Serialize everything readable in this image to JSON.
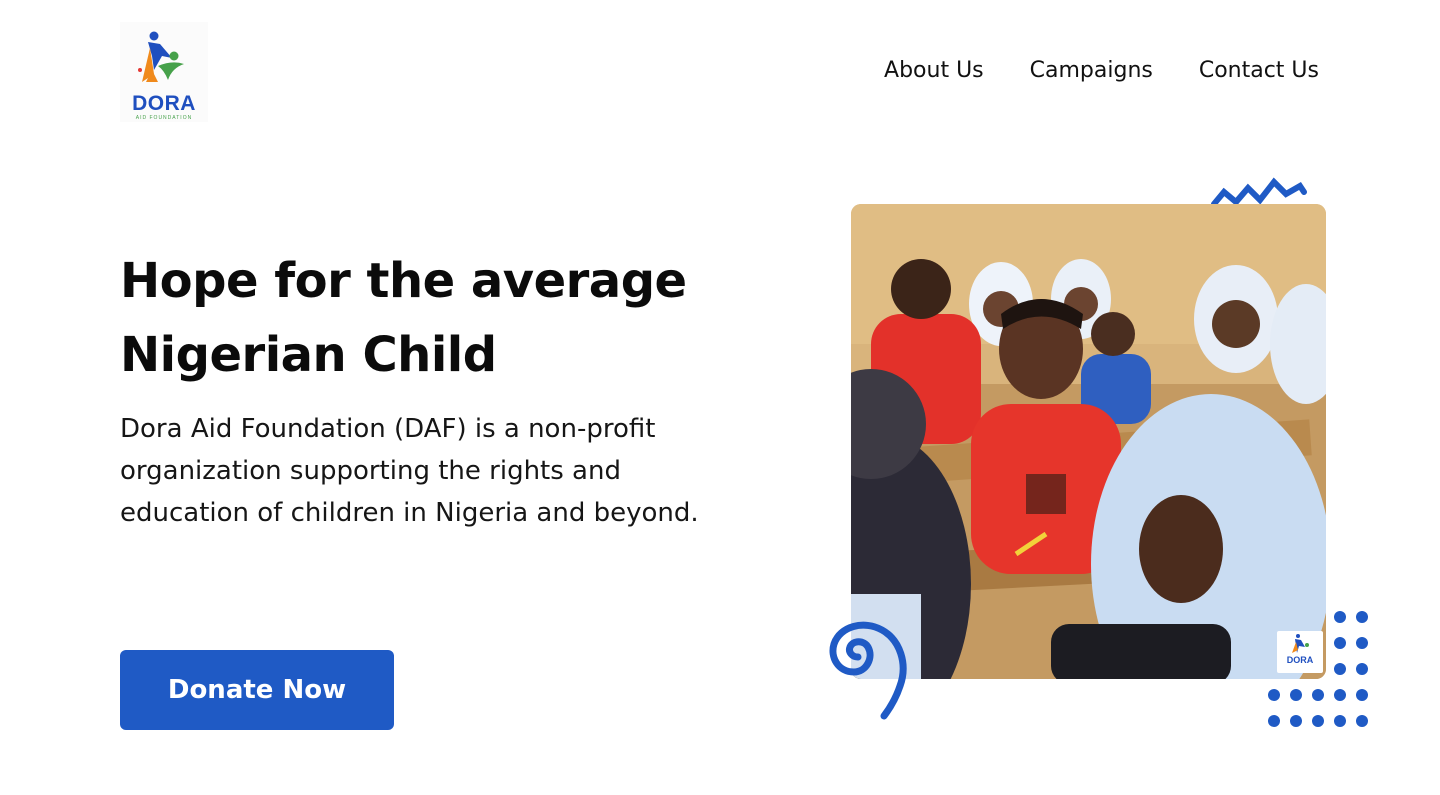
{
  "header": {
    "logo": {
      "name": "DORA",
      "subtitle": "AID FOUNDATION"
    },
    "nav": [
      "About Us",
      "Campaigns",
      "Contact Us"
    ]
  },
  "hero": {
    "title_line1": "Hope for the average",
    "title_line2": "Nigerian Child",
    "description": "Dora Aid Foundation (DAF) is a non-profit organization supporting the rights and education of children in Nigeria and beyond.",
    "cta_label": "Donate Now"
  },
  "photo": {
    "subject": "classroom-students-photo",
    "badge": {
      "name": "DORA"
    }
  },
  "colors": {
    "brand_blue": "#1f5ac5",
    "logo_green": "#46a14a",
    "logo_orange": "#f08a1c",
    "text": "#111111",
    "background": "#ffffff"
  },
  "icons": [
    "zigzag-decoration-icon",
    "spiral-decoration-icon",
    "dot-grid-decoration-icon",
    "dora-logo-icon"
  ]
}
